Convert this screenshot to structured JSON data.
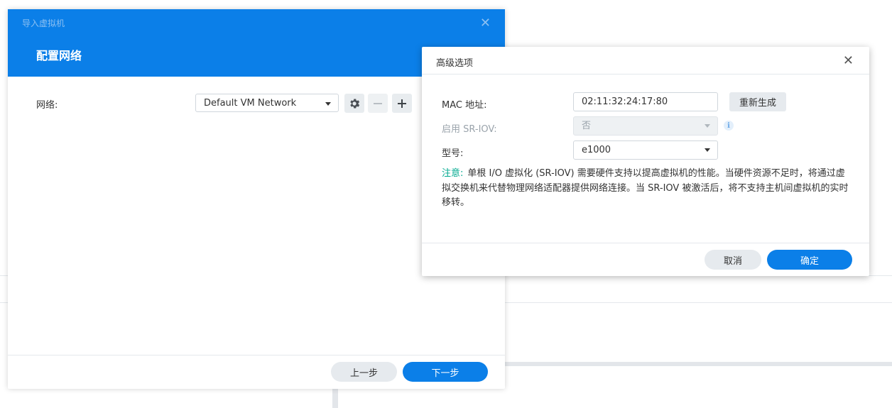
{
  "wizard": {
    "window_title": "导入虚拟机",
    "heading": "配置网络",
    "network_label": "网络:",
    "network_value": "Default VM Network",
    "prev_label": "上一步",
    "next_label": "下一步"
  },
  "advanced": {
    "title": "高级选项",
    "mac_label": "MAC 地址:",
    "mac_value": "02:11:32:24:17:80",
    "regenerate_label": "重新生成",
    "sriov_label": "启用 SR-IOV:",
    "sriov_value": "否",
    "model_label": "型号:",
    "model_value": "e1000",
    "note_label": "注意:",
    "note_text": "单根 I/O 虚拟化 (SR-IOV) 需要硬件支持以提高虚拟机的性能。当硬件资源不足时，将通过虚拟交换机来代替物理网络适配器提供网络连接。当 SR-IOV 被激活后，将不支持主机间虚拟机的实时移转。",
    "cancel_label": "取消",
    "ok_label": "确定"
  },
  "colors": {
    "accent": "#0b7fe8",
    "note_label": "#00a98f"
  }
}
